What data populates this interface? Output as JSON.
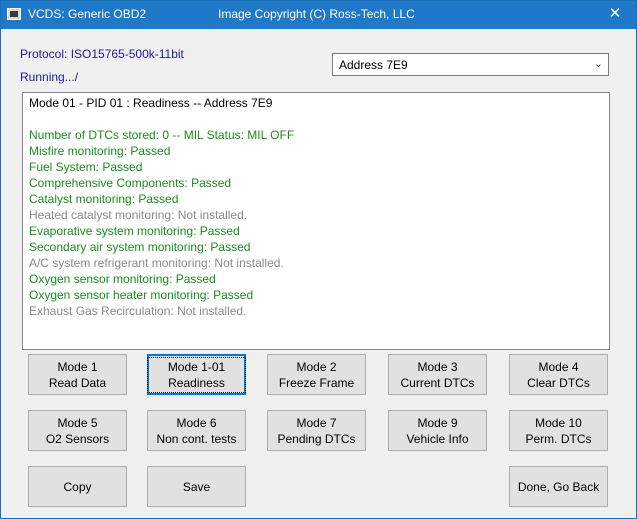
{
  "window": {
    "title_left": "VCDS:  Generic OBD2",
    "title_center": "Image Copyright (C) Ross-Tech, LLC",
    "close_glyph": "✕",
    "app_icon": "vcds-app-icon"
  },
  "header": {
    "protocol": "Protocol: ISO15765-500k-11bit",
    "status": "Running.../"
  },
  "address_select": {
    "value": "Address 7E9",
    "chevron": "⌄"
  },
  "output": {
    "lines": [
      {
        "text": "Mode 01 - PID 01 : Readiness  --  Address 7E9",
        "color": "#000000"
      },
      {
        "text": "",
        "color": "#000000"
      },
      {
        "text": "Number of DTCs stored: 0  --  MIL Status: MIL OFF",
        "color": "#1e8c1e"
      },
      {
        "text": "Misfire monitoring:  Passed",
        "color": "#1e8c1e"
      },
      {
        "text": "Fuel System:  Passed",
        "color": "#1e8c1e"
      },
      {
        "text": "Comprehensive Components:  Passed",
        "color": "#1e8c1e"
      },
      {
        "text": "Catalyst monitoring:  Passed",
        "color": "#1e8c1e"
      },
      {
        "text": "Heated catalyst monitoring: Not installed.",
        "color": "#8a8a8a"
      },
      {
        "text": "Evaporative system monitoring:  Passed",
        "color": "#1e8c1e"
      },
      {
        "text": "Secondary air system monitoring:  Passed",
        "color": "#1e8c1e"
      },
      {
        "text": "A/C system refrigerant monitoring: Not installed.",
        "color": "#8a8a8a"
      },
      {
        "text": "Oxygen sensor monitoring:  Passed",
        "color": "#1e8c1e"
      },
      {
        "text": "Oxygen sensor heater monitoring:  Passed",
        "color": "#1e8c1e"
      },
      {
        "text": "Exhaust Gas Recirculation: Not installed.",
        "color": "#8a8a8a"
      }
    ]
  },
  "buttons": {
    "mode1": {
      "line1": "Mode 1",
      "line2": "Read Data"
    },
    "mode1_01": {
      "line1": "Mode 1-01",
      "line2": "Readiness"
    },
    "mode2": {
      "line1": "Mode 2",
      "line2": "Freeze Frame"
    },
    "mode3": {
      "line1": "Mode 3",
      "line2": "Current DTCs"
    },
    "mode4": {
      "line1": "Mode 4",
      "line2": "Clear DTCs"
    },
    "mode5": {
      "line1": "Mode 5",
      "line2": "O2 Sensors"
    },
    "mode6": {
      "line1": "Mode 6",
      "line2": "Non cont. tests"
    },
    "mode7": {
      "line1": "Mode 7",
      "line2": "Pending DTCs"
    },
    "mode9": {
      "line1": "Mode 9",
      "line2": "Vehicle Info"
    },
    "mode10": {
      "line1": "Mode 10",
      "line2": "Perm. DTCs"
    },
    "copy": "Copy",
    "save": "Save",
    "done": "Done, Go Back"
  },
  "colors": {
    "titlebar": "#1f78c8",
    "header_text": "#1a1a9c",
    "passed": "#1e8c1e",
    "not_installed": "#8a8a8a"
  }
}
